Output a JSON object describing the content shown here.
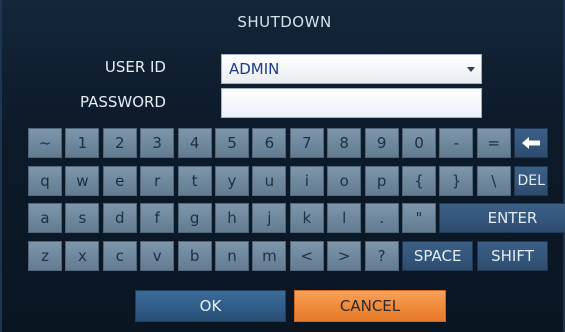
{
  "dialog": {
    "title": "SHUTDOWN"
  },
  "form": {
    "user_id_label": "USER ID",
    "user_id_value": "ADMIN",
    "password_label": "PASSWORD",
    "password_value": ""
  },
  "keyboard": {
    "rows": [
      [
        "~",
        "1",
        "2",
        "3",
        "4",
        "5",
        "6",
        "7",
        "8",
        "9",
        "0",
        "-",
        "=",
        "backspace"
      ],
      [
        "q",
        "w",
        "e",
        "r",
        "t",
        "y",
        "u",
        "i",
        "o",
        "p",
        "{",
        "}",
        "\\",
        "DEL"
      ],
      [
        "a",
        "s",
        "d",
        "f",
        "g",
        "h",
        "j",
        "k",
        "l",
        ".",
        "\"",
        "ENTER"
      ],
      [
        "z",
        "x",
        "c",
        "v",
        "b",
        "n",
        "m",
        "<",
        ">",
        "?",
        "SPACE",
        "SHIFT"
      ]
    ],
    "backspace_icon": "backspace-arrow-icon"
  },
  "actions": {
    "ok_label": "OK",
    "cancel_label": "CANCEL"
  },
  "colors": {
    "key": "#6e879c",
    "function_key": "#33557a",
    "ok": "#2f5b86",
    "cancel": "#f08a3a"
  }
}
